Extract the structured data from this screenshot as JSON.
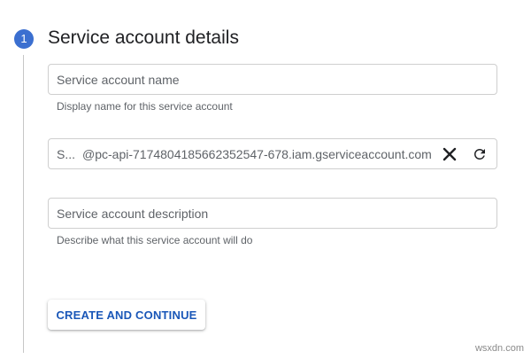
{
  "step": {
    "number": "1",
    "title": "Service account details"
  },
  "name_field": {
    "placeholder": "Service account name",
    "value": "",
    "helper": "Display name for this service account"
  },
  "id_field": {
    "prefix": "S...",
    "suffix": "@pc-api-7174804185662352547-678.iam.gserviceaccount.com",
    "clear_icon": "close-icon",
    "refresh_icon": "refresh-icon"
  },
  "description_field": {
    "placeholder": "Service account description",
    "value": "",
    "helper": "Describe what this service account will do"
  },
  "actions": {
    "create_label": "CREATE AND CONTINUE"
  },
  "watermark": "wsxdn.com",
  "colors": {
    "accent": "#3b6fd0",
    "button_text": "#1a57b8",
    "border": "#cfcfcf",
    "muted_text": "#5f6368"
  }
}
